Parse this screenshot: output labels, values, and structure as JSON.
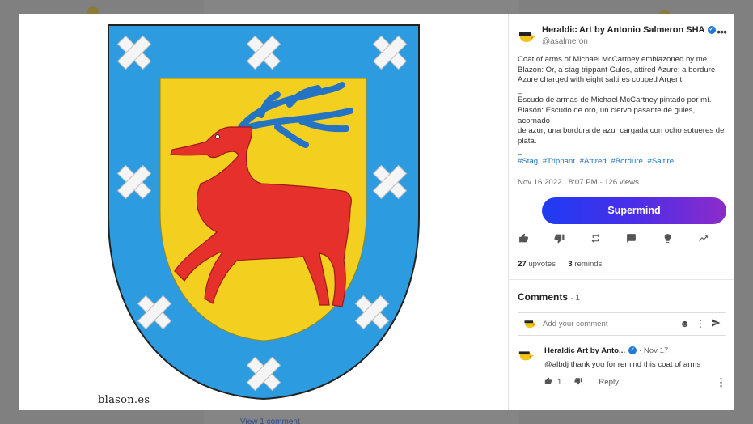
{
  "background": {
    "view_comment_link": "View 1 comment"
  },
  "media": {
    "watermark": "blason.es"
  },
  "post": {
    "owner_name": "Heraldic Art by Antonio Salmeron SHA",
    "owner_handle": "@asalmeron",
    "body": {
      "line1": "Coat of arms of Michael McCartney emblazoned by me.",
      "line2": "Blazon: Or, a stag trippant Gules, attired Azure; a bordure",
      "line3": "Azure charged with eight saltires couped Argent.",
      "sep1": "_",
      "line4": "Escudo de armas de Michael McCartney pintado por mí.",
      "line5": "Blasón: Escudo de oro, un ciervo pasante de gules, acornado",
      "line6": "de azur; una bordura de azur cargada con ocho sotueres de",
      "line7": "plata.",
      "sep2": "_"
    },
    "hashtags": [
      "#Stag",
      "#Trippant",
      "#Attired",
      "#Bordure",
      "#Saltire"
    ],
    "date": "Nov 16 2022 · 8:07 PM",
    "views": "126 views",
    "supermind_label": "Supermind",
    "upvotes_count": "27",
    "upvotes_label": "upvotes",
    "reminds_count": "3",
    "reminds_label": "reminds"
  },
  "comments": {
    "heading": "Comments",
    "count": "· 1",
    "input_placeholder": "Add your comment",
    "items": [
      {
        "author": "Heraldic Art by Anto...",
        "time": "· Nov 17",
        "text": "@albdj thank you for remind this coat of arms",
        "upvotes": "1",
        "reply_label": "Reply"
      }
    ]
  },
  "colors": {
    "accent_blue": "#1b74c5",
    "verified": "#1e7ad6",
    "shield_field": "#f3cf1f",
    "bordure": "#2d9be0",
    "stag": "#e5302b"
  }
}
